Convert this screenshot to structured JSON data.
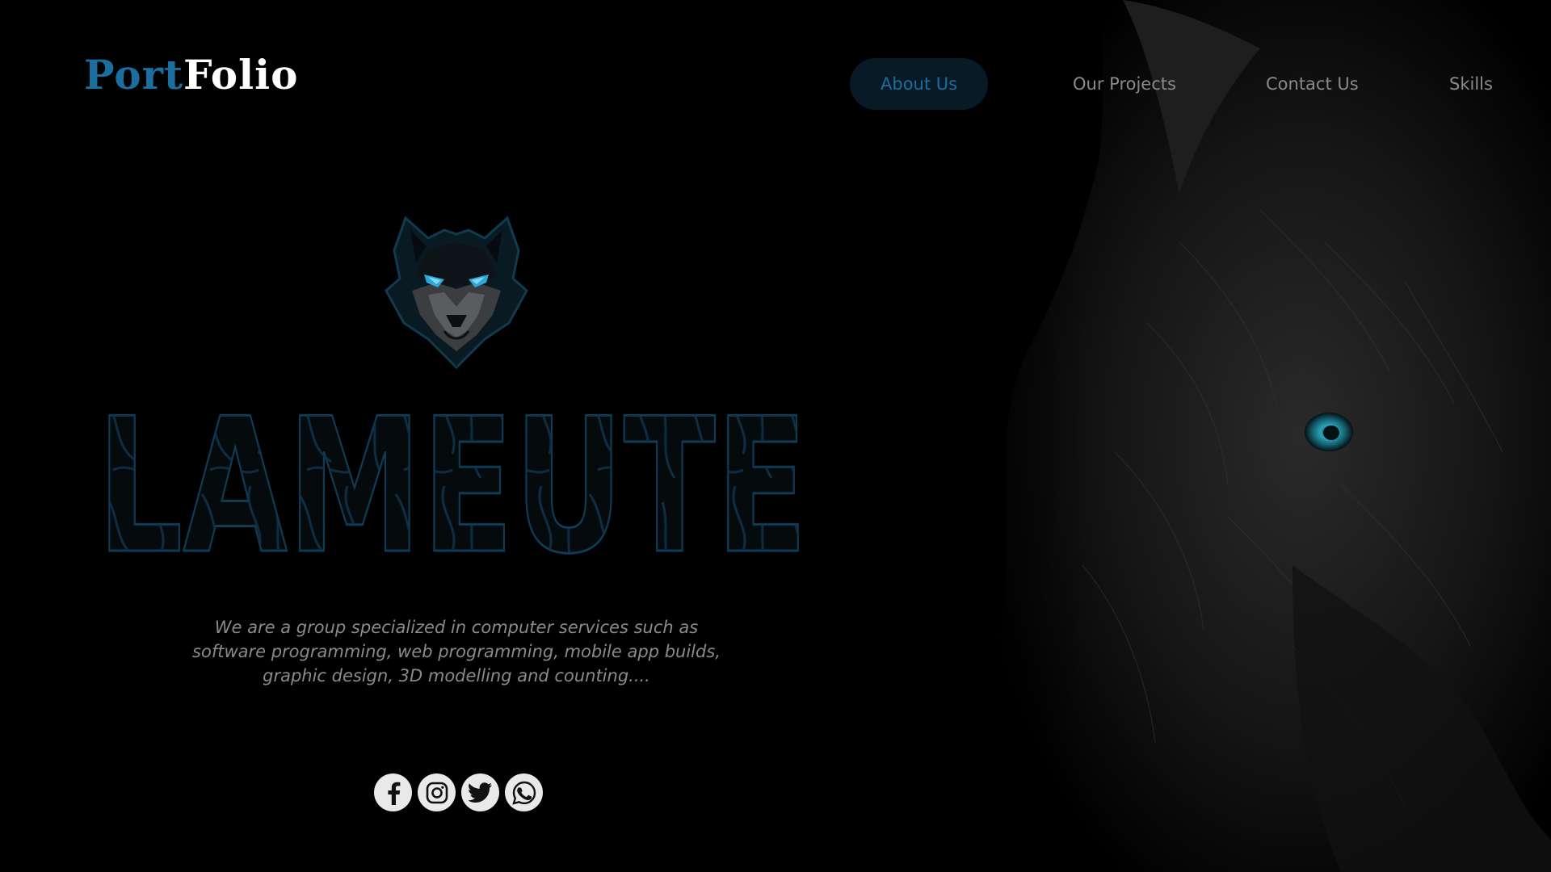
{
  "brand": {
    "part1": "Port",
    "part2": "Folio",
    "part1_color": "#1a6f9f",
    "part2_color": "#ffffff"
  },
  "nav": {
    "items": [
      {
        "label": "About Us",
        "active": true
      },
      {
        "label": "Our Projects",
        "active": false
      },
      {
        "label": "Contact Us",
        "active": false
      },
      {
        "label": "Skills",
        "active": false
      }
    ]
  },
  "hero": {
    "title": "LAMEUTE",
    "emblem_icon": "wolf-head-icon",
    "description_lines": [
      "We are a group specialized in computer services such as",
      "software programming, web programming, mobile app builds,",
      "graphic design, 3D modelling and counting...."
    ],
    "photo_icon": "wolf-photo"
  },
  "socials": [
    {
      "icon": "facebook-icon"
    },
    {
      "icon": "instagram-icon"
    },
    {
      "icon": "twitter-icon"
    },
    {
      "icon": "whatsapp-icon"
    }
  ],
  "colors": {
    "accent": "#1a6f9f",
    "background": "#000000",
    "text_muted": "#8a8a8a",
    "eye_glow": "#2ea7d8"
  }
}
